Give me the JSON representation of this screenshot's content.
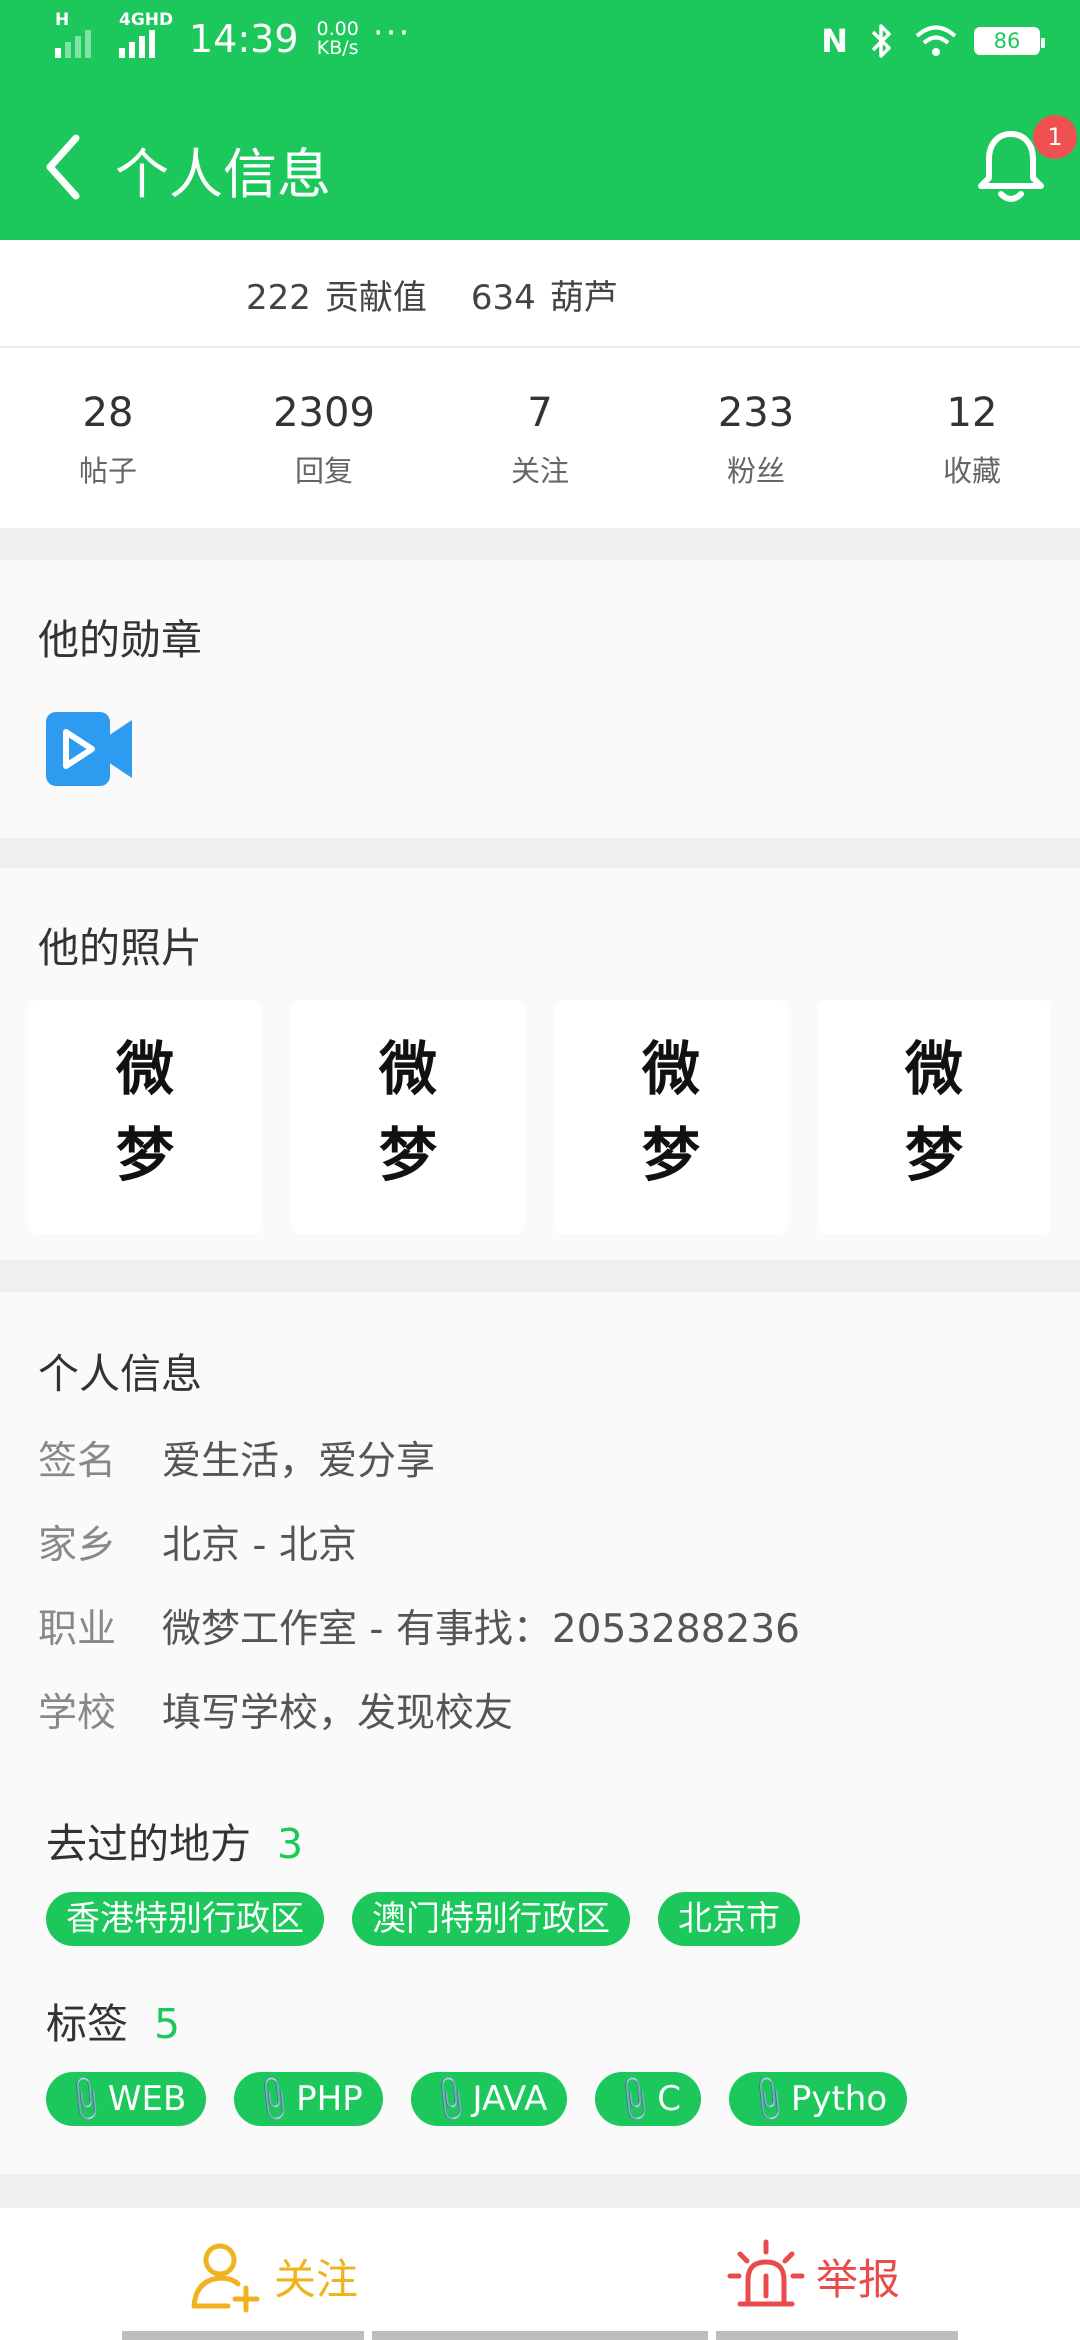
{
  "status_bar": {
    "time": "14:39",
    "network_1": "H",
    "network_2": "4GHD",
    "speed_value": "0.00",
    "speed_unit": "KB/s",
    "more": "···",
    "nfc": "N",
    "battery": "86"
  },
  "header": {
    "back_icon": "chevron-left-icon",
    "title": "个人信息",
    "bell_icon": "bell-icon",
    "notification_count": "1"
  },
  "contribution": {
    "contrib_value": "222",
    "contrib_label": "贡献值",
    "gourd_value": "634",
    "gourd_label": "葫芦"
  },
  "stats": [
    {
      "value": "28",
      "label": "帖子"
    },
    {
      "value": "2309",
      "label": "回复"
    },
    {
      "value": "7",
      "label": "关注"
    },
    {
      "value": "233",
      "label": "粉丝"
    },
    {
      "value": "12",
      "label": "收藏"
    }
  ],
  "medals": {
    "title": "他的勋章",
    "items": [
      {
        "icon": "video-camera-icon",
        "color": "#2d9bf0"
      }
    ]
  },
  "photos": {
    "title": "他的照片",
    "items": [
      {
        "line1": "微",
        "line2": "梦"
      },
      {
        "line1": "微",
        "line2": "梦"
      },
      {
        "line1": "微",
        "line2": "梦"
      },
      {
        "line1": "微",
        "line2": "梦"
      }
    ]
  },
  "profile": {
    "title": "个人信息",
    "rows": [
      {
        "key": "签名",
        "value": "爱生活，爱分享"
      },
      {
        "key": "家乡",
        "value": "北京 - 北京"
      },
      {
        "key": "职业",
        "value": "微梦工作室 - 有事找：2053288236"
      },
      {
        "key": "学校",
        "value": "填写学校，发现校友"
      }
    ]
  },
  "places": {
    "title": "去过的地方",
    "count": "3",
    "items": [
      "香港特别行政区",
      "澳门特别行政区",
      "北京市"
    ]
  },
  "tags": {
    "title": "标签",
    "count": "5",
    "items": [
      "WEB",
      "PHP",
      "JAVA",
      "C",
      "Pytho"
    ]
  },
  "bottom_bar": {
    "follow_label": "关注",
    "report_label": "举报"
  },
  "colors": {
    "brand_green": "#1cc85b",
    "follow_yellow": "#f0b31d",
    "report_red": "#e94b4b",
    "badge_red": "#f05150"
  }
}
